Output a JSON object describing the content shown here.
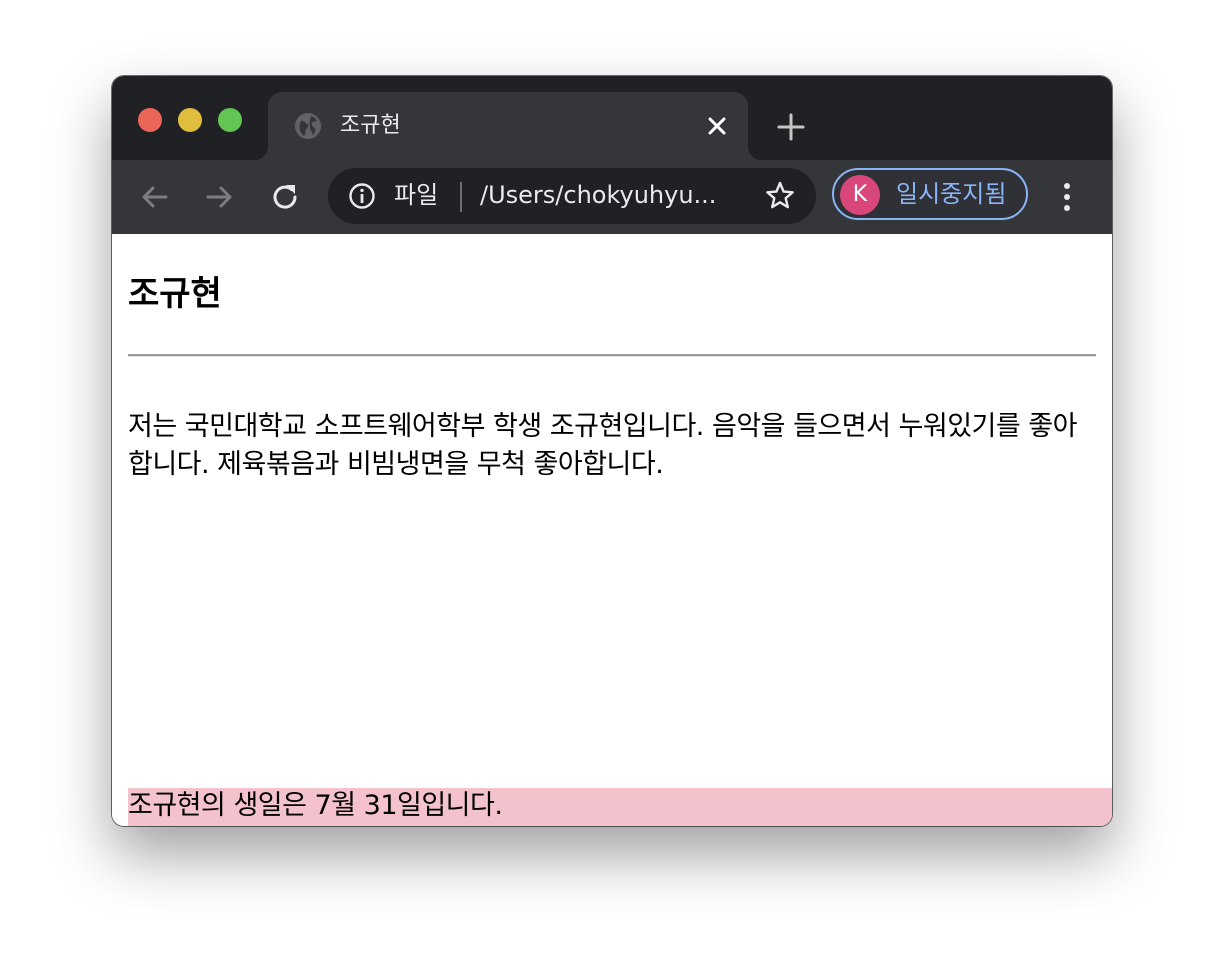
{
  "browser": {
    "tab": {
      "title": "조규현"
    },
    "address_bar": {
      "scheme_label": "파일",
      "url": "/Users/chokyuhyu..."
    },
    "profile": {
      "avatar_letter": "K",
      "status_label": "일시중지됨"
    },
    "colors": {
      "tabstrip_bg": "#202124",
      "active_tab_bg": "#35363a",
      "profile_accent": "#8ab4f8",
      "avatar_bg": "#d9477a"
    }
  },
  "page": {
    "heading": "조규현",
    "intro": "저는 국민대학교 소프트웨어학부 학생 조규현입니다. 음악을 들으면서 누워있기를 좋아합니다. 제육볶음과 비빔냉면을 무척 좋아합니다.",
    "footer_text": "조규현의 생일은 7월 31일입니다.",
    "footer_bg": "#f4c2cc"
  }
}
